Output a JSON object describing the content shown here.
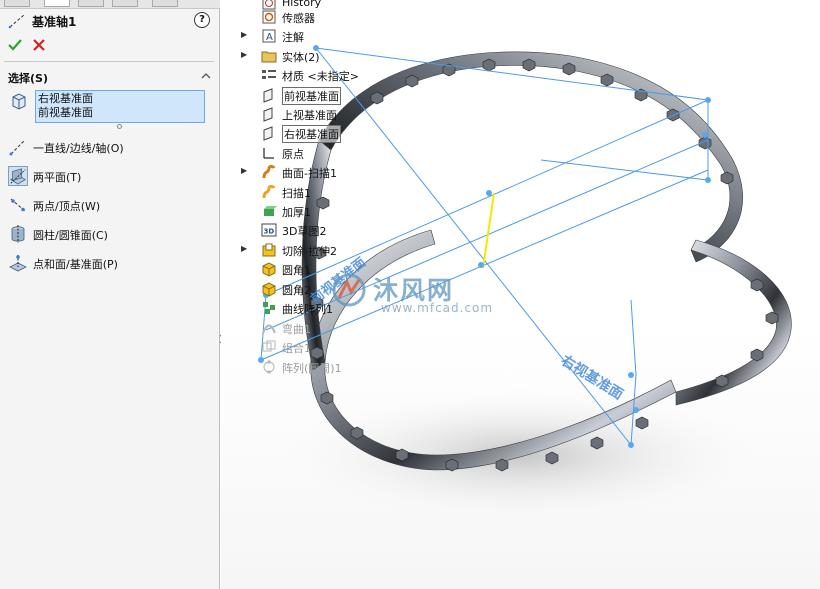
{
  "property_manager": {
    "title": "基准轴1",
    "help": "?",
    "section_title": "选择(S)",
    "selections": [
      "右视基准面",
      "前视基准面"
    ],
    "options": [
      {
        "label": "一直线/边线/轴(O)",
        "icon": "line-edge-axis-icon",
        "selected": false
      },
      {
        "label": "两平面(T)",
        "icon": "two-planes-icon",
        "selected": true
      },
      {
        "label": "两点/顶点(W)",
        "icon": "two-points-icon",
        "selected": false
      },
      {
        "label": "圆柱/圆锥面(C)",
        "icon": "cylinder-cone-icon",
        "selected": false
      },
      {
        "label": "点和面/基准面(P)",
        "icon": "point-and-plane-icon",
        "selected": false
      }
    ]
  },
  "feature_tree": {
    "items": [
      {
        "label": "History",
        "icon": "history-icon",
        "expand": ""
      },
      {
        "label": "传感器",
        "icon": "sensor-icon",
        "expand": ""
      },
      {
        "label": "注解",
        "icon": "annotation-icon",
        "expand": "▶"
      },
      {
        "label": "实体(2)",
        "icon": "solid-bodies-folder-icon",
        "expand": "▶"
      },
      {
        "label": "材质 <未指定>",
        "icon": "material-icon",
        "expand": ""
      },
      {
        "label": "前视基准面",
        "icon": "plane-icon",
        "expand": ""
      },
      {
        "label": "上视基准面",
        "icon": "plane-icon",
        "expand": ""
      },
      {
        "label": "右视基准面",
        "icon": "plane-icon",
        "expand": ""
      },
      {
        "label": "原点",
        "icon": "origin-icon",
        "expand": ""
      },
      {
        "label": "曲面-扫描1",
        "icon": "surface-sweep-icon",
        "expand": "▶"
      },
      {
        "label": "扫描1",
        "icon": "sweep-icon",
        "expand": ""
      },
      {
        "label": "加厚1",
        "icon": "thicken-icon",
        "expand": ""
      },
      {
        "label": "3D草图2",
        "icon": "3d-sketch-icon",
        "expand": ""
      },
      {
        "label": "切除-拉伸2",
        "icon": "cut-extrude-icon",
        "expand": "▶"
      },
      {
        "label": "圆角1",
        "icon": "fillet-icon",
        "expand": ""
      },
      {
        "label": "圆角2",
        "icon": "fillet-icon",
        "expand": ""
      },
      {
        "label": "曲线阵列1",
        "icon": "curve-pattern-icon",
        "expand": ""
      },
      {
        "label": "弯曲1",
        "icon": "flex-icon",
        "expand": ""
      },
      {
        "label": "组合1",
        "icon": "combine-icon",
        "expand": ""
      },
      {
        "label": "阵列(圆周)1",
        "icon": "circular-pattern-icon",
        "expand": ""
      }
    ]
  },
  "viewport": {
    "plane_label_right": "右视基准面",
    "plane_label_front": "前视基准面",
    "watermark_main": "沐风网",
    "watermark_url": "www.mfcad.com"
  },
  "colors": {
    "plane_line": "#4a9be8",
    "plane_handle": "#58a8f0",
    "axis_preview": "#f5e800",
    "ok_green": "#2aa52a",
    "cancel_red": "#d42020",
    "selection_bg": "#cfe6fb"
  }
}
